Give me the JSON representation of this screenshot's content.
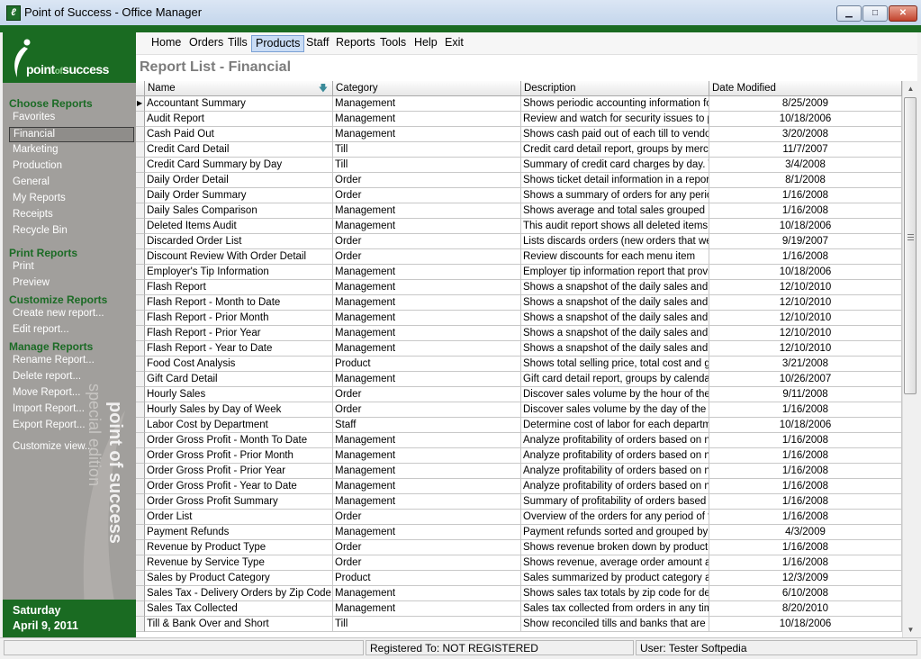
{
  "window": {
    "title": "Point of Success - Office Manager"
  },
  "logo": {
    "brand_part1": "point",
    "brand_part2": "of",
    "brand_part3": "success",
    "watermark_line1": "point of success",
    "watermark_line2": "special edition"
  },
  "menu": {
    "items": [
      {
        "label": "Home"
      },
      {
        "label": "Orders"
      },
      {
        "label": "Tills"
      },
      {
        "label": "Products"
      },
      {
        "label": "Staff"
      },
      {
        "label": "Reports"
      },
      {
        "label": "Tools"
      },
      {
        "label": "Help"
      },
      {
        "label": "Exit"
      }
    ],
    "active_item": "Products"
  },
  "page": {
    "title": "Report List - Financial"
  },
  "sidebar": {
    "sections": [
      {
        "title": "Choose Reports",
        "items": [
          "Favorites",
          "Financial",
          "Marketing",
          "Production",
          "General",
          "My Reports",
          "Receipts",
          "Recycle Bin"
        ]
      },
      {
        "title": "Print Reports",
        "items": [
          "Print",
          "Preview"
        ]
      },
      {
        "title": "Customize Reports",
        "items": [
          "Create new report...",
          "Edit report..."
        ]
      },
      {
        "title": "Manage Reports",
        "items": [
          "Rename Report...",
          "Delete report...",
          "Move Report...",
          "Import Report...",
          "Export Report..."
        ]
      }
    ],
    "selected_item": "Financial",
    "customize_view": "Customize view...",
    "date_day": "Saturday",
    "date_full": "April 9, 2011"
  },
  "table": {
    "columns": [
      "Name",
      "Category",
      "Description",
      "Date Modified"
    ],
    "sorted_column": "Name",
    "rows": [
      [
        "Accountant Summary",
        "Management",
        "Shows periodic accounting information for th",
        "8/25/2009"
      ],
      [
        "Audit Report",
        "Management",
        "Review and watch for security issues to pro",
        "10/18/2006"
      ],
      [
        "Cash Paid Out",
        "Management",
        "Shows cash paid out of each till to vendors",
        "3/20/2008"
      ],
      [
        "Credit Card Detail",
        "Till",
        "Credit card detail report, groups by merchan",
        "11/7/2007"
      ],
      [
        "Credit Card Summary by Day",
        "Till",
        "Summary of credit card charges by day. This",
        "3/4/2008"
      ],
      [
        "Daily Order Detail",
        "Order",
        "Shows ticket detail information in a report fo",
        "8/1/2008"
      ],
      [
        "Daily Order Summary",
        "Order",
        "Shows a summary of orders for any period o",
        "1/16/2008"
      ],
      [
        "Daily Sales Comparison",
        "Management",
        "Shows average and total sales grouped by d",
        "1/16/2008"
      ],
      [
        "Deleted Items Audit",
        "Management",
        "This audit report shows all deleted items",
        "10/18/2006"
      ],
      [
        "Discarded Order List",
        "Order",
        "Lists discards orders (new orders that were n",
        "9/19/2007"
      ],
      [
        "Discount Review With Order Detail",
        "Order",
        "Review discounts for each menu item",
        "1/16/2008"
      ],
      [
        "Employer's Tip Information",
        "Management",
        "Employer tip information report that provides",
        "10/18/2006"
      ],
      [
        "Flash Report",
        "Management",
        "Shows a snapshot of the daily sales and oth",
        "12/10/2010"
      ],
      [
        "Flash Report - Month to Date",
        "Management",
        "Shows a snapshot of the daily sales and oth",
        "12/10/2010"
      ],
      [
        "Flash Report - Prior Month",
        "Management",
        "Shows a snapshot of the daily sales and oth",
        "12/10/2010"
      ],
      [
        "Flash Report - Prior Year",
        "Management",
        "Shows a snapshot of the daily sales and oth",
        "12/10/2010"
      ],
      [
        "Flash Report - Year to Date",
        "Management",
        "Shows a snapshot of the daily sales and oth",
        "12/10/2010"
      ],
      [
        "Food Cost Analysis",
        "Product",
        "Shows total selling price, total cost and gros",
        "3/21/2008"
      ],
      [
        "Gift Card Detail",
        "Management",
        "Gift card detail report, groups by calendar da",
        "10/26/2007"
      ],
      [
        "Hourly Sales",
        "Order",
        "Discover sales volume by the hour of the da",
        "9/11/2008"
      ],
      [
        "Hourly Sales by Day of Week",
        "Order",
        "Discover sales volume by the day of the we",
        "1/16/2008"
      ],
      [
        "Labor Cost by Department",
        "Staff",
        "Determine cost of labor for each department",
        "10/18/2006"
      ],
      [
        "Order Gross Profit - Month To Date",
        "Management",
        "Analyze profitability of orders based on net s",
        "1/16/2008"
      ],
      [
        "Order Gross Profit - Prior Month",
        "Management",
        "Analyze profitability of orders based on net s",
        "1/16/2008"
      ],
      [
        "Order Gross Profit - Prior Year",
        "Management",
        "Analyze profitability of orders based on net s",
        "1/16/2008"
      ],
      [
        "Order Gross Profit - Year to Date",
        "Management",
        "Analyze profitability of orders based on net s",
        "1/16/2008"
      ],
      [
        "Order Gross Profit Summary",
        "Management",
        "Summary of profitability of orders based on n",
        "1/16/2008"
      ],
      [
        "Order List",
        "Order",
        "Overview of the orders for any period of time",
        "1/16/2008"
      ],
      [
        "Payment Refunds",
        "Management",
        "Payment refunds sorted and grouped by Bus",
        "4/3/2009"
      ],
      [
        "Revenue by Product Type",
        "Order",
        "Shows revenue broken down by product ca",
        "1/16/2008"
      ],
      [
        "Revenue by Service Type",
        "Order",
        "Shows revenue, average order amount and",
        "1/16/2008"
      ],
      [
        "Sales by Product Category",
        "Product",
        "Sales summarized by product category and",
        "12/3/2009"
      ],
      [
        "Sales Tax - Delivery Orders by Zip Code",
        "Management",
        "Shows sales tax totals by zip code for delive",
        "6/10/2008"
      ],
      [
        "Sales Tax Collected",
        "Management",
        "Sales tax collected from orders in any time p",
        "8/20/2010"
      ],
      [
        "Till & Bank Over and Short",
        "Till",
        "Show reconciled tills and banks that are ove",
        "10/18/2006"
      ]
    ]
  },
  "status": {
    "left": "",
    "registered": "Registered To: NOT REGISTERED",
    "user": "User: Tester Softpedia"
  },
  "colors": {
    "brand_green": "#1a6b22",
    "sidebar_gray": "#a19f9c",
    "section_title_green": "#1b6b25",
    "title_gray": "#7c7c7c"
  }
}
